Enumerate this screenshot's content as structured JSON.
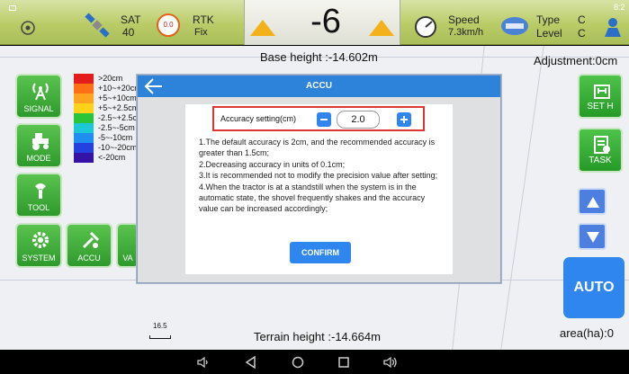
{
  "status": {
    "sat_label": "SAT",
    "sat_value": "40",
    "dop_value": "0.0",
    "rtk_label": "RTK",
    "rtk_value": "Fix",
    "heading_value": "-6",
    "speed_label": "Speed",
    "speed_value": "7.3km/h",
    "type_label": "Type",
    "type_value": "C",
    "level_label": "Level",
    "level_value": "C",
    "sys_text": "8:2"
  },
  "map": {
    "base_height": "Base height :-14.602m",
    "adjustment": "Adjustment:0cm",
    "terrain_height": "Terrain height :-14.664m",
    "area": "area(ha):0",
    "scale": "16.5"
  },
  "legend": [
    {
      "label": ">20cm",
      "color": "#e41c1c"
    },
    {
      "label": "+10~+20cm",
      "color": "#ff6f16"
    },
    {
      "label": "+5~+10cm",
      "color": "#ffa41f"
    },
    {
      "label": "+5~+2.5cm",
      "color": "#ffd21a"
    },
    {
      "label": "-2.5~+2.5cm",
      "color": "#28c43a"
    },
    {
      "label": "-2.5~-5cm",
      "color": "#1dc8d6"
    },
    {
      "label": "-5~-10cm",
      "color": "#1f8ef0"
    },
    {
      "label": "-10~-20cm",
      "color": "#2241e0"
    },
    {
      "label": "<-20cm",
      "color": "#3412a6"
    }
  ],
  "left_buttons": {
    "signal": "SIGNAL",
    "mode": "MODE",
    "tool": "TOOL",
    "system": "SYSTEM",
    "accu": "ACCU",
    "va": "VA"
  },
  "right_buttons": {
    "set_h": "SET H",
    "task": "TASK",
    "auto": "AUTO"
  },
  "dialog": {
    "title": "ACCU",
    "accuracy_label": "Accuracy setting(cm)",
    "accuracy_value": "2.0",
    "instructions": [
      "1.The default accuracy is 2cm, and the recommended accuracy is greater than 1.5cm;",
      "2.Decreasing accuracy in units of 0.1cm;",
      "3.It is recommended not to modify the precision value after setting;",
      "4.When the tractor is at a standstill when the system is in the automatic state, the shovel frequently shakes and the accuracy value can be increased accordingly;"
    ],
    "confirm_label": "CONFIRM"
  },
  "colors": {
    "statusbar": "#b9cc67",
    "button_green": "#2e9a2c",
    "dialog_header": "#2d82d9",
    "accent_blue": "#2f86ef",
    "highlight_red": "#e03535"
  }
}
